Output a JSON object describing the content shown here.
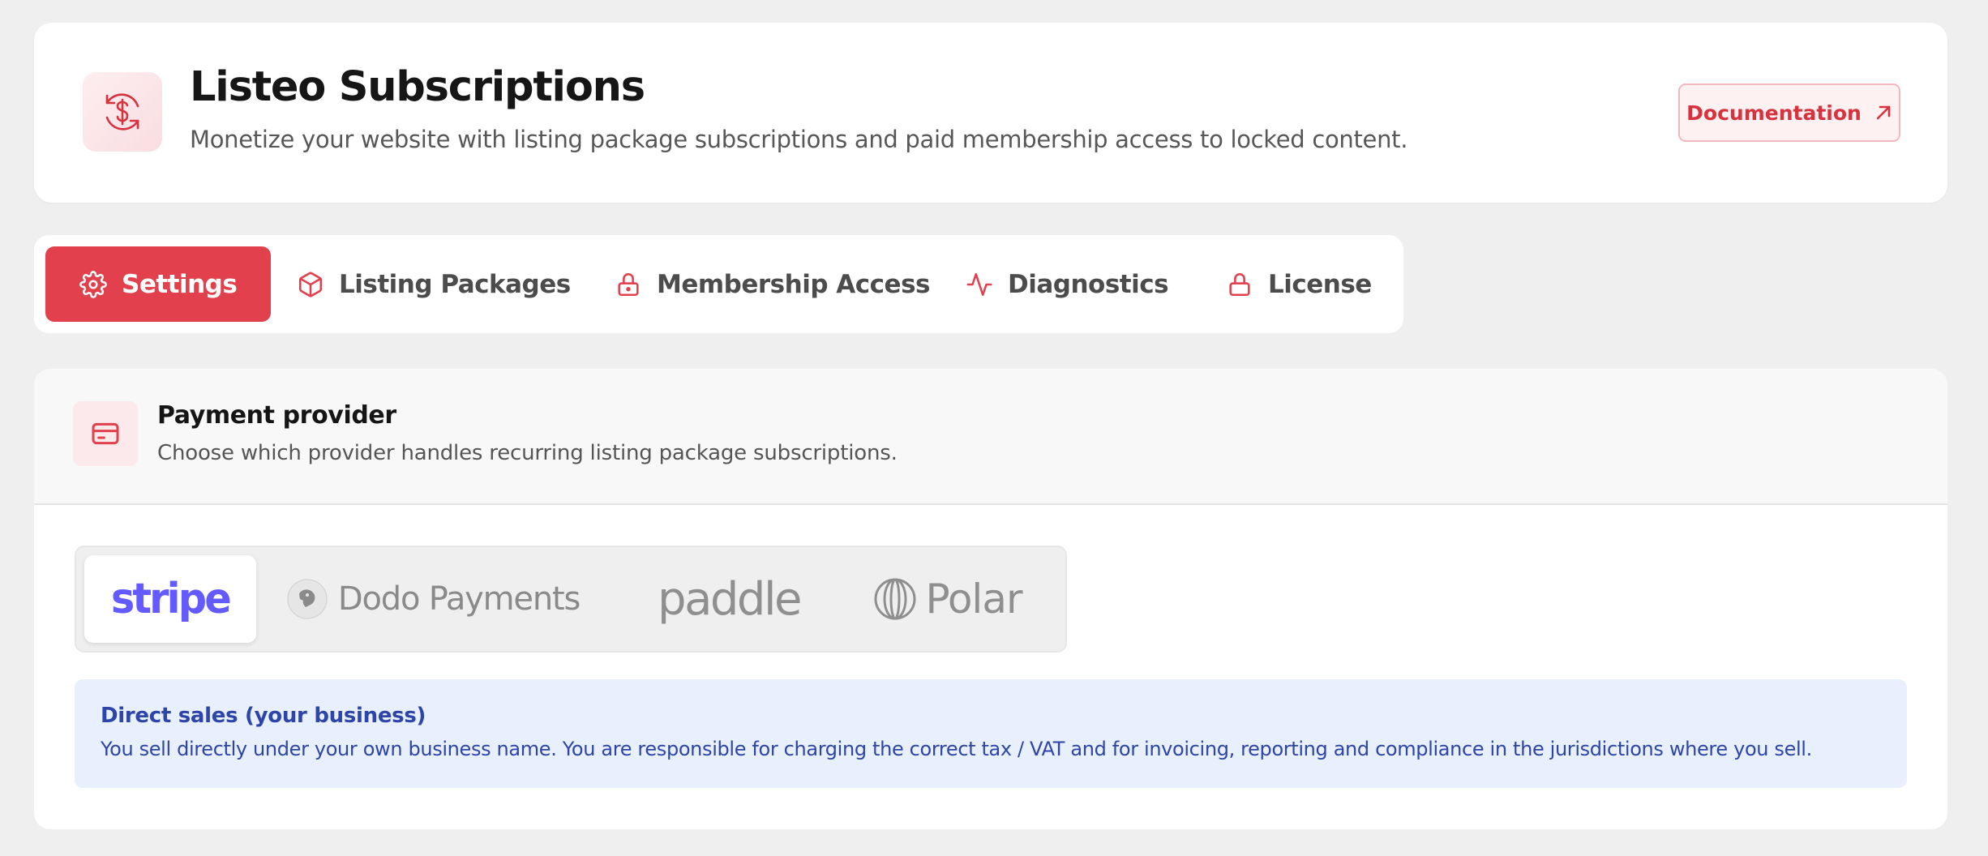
{
  "header": {
    "title": "Listeo Subscriptions",
    "subtitle": "Monetize your website with listing package subscriptions and paid membership access to locked content.",
    "documentation_label": "Documentation",
    "logo_icon": "currency-refresh-icon",
    "link_icon": "external-arrow-icon"
  },
  "tabs": [
    {
      "label": "Settings",
      "icon": "gear-icon",
      "active": true
    },
    {
      "label": "Listing Packages",
      "icon": "package-icon",
      "active": false
    },
    {
      "label": "Membership Access",
      "icon": "lock-icon",
      "active": false
    },
    {
      "label": "Diagnostics",
      "icon": "pulse-icon",
      "active": false
    },
    {
      "label": "License",
      "icon": "lock-icon",
      "active": false
    }
  ],
  "payment_provider": {
    "title": "Payment provider",
    "description": "Choose which provider handles recurring listing package subscriptions.",
    "icon": "credit-card-icon",
    "providers": [
      {
        "label": "stripe",
        "selected": true
      },
      {
        "label": "Dodo Payments",
        "selected": false
      },
      {
        "label": "paddle",
        "selected": false
      },
      {
        "label": "Polar",
        "selected": false
      }
    ],
    "info": {
      "title": "Direct sales (your business)",
      "text": "You sell directly under your own business name. You are responsible for charging the correct tax / VAT and for invoicing, reporting and compliance in the jurisdictions where you sell."
    }
  },
  "colors": {
    "accent": "#e2404d",
    "page_background": "#efefef",
    "stripe_brand": "#635bff",
    "info_text": "#2d44a8",
    "info_background": "#e9f0fd"
  }
}
